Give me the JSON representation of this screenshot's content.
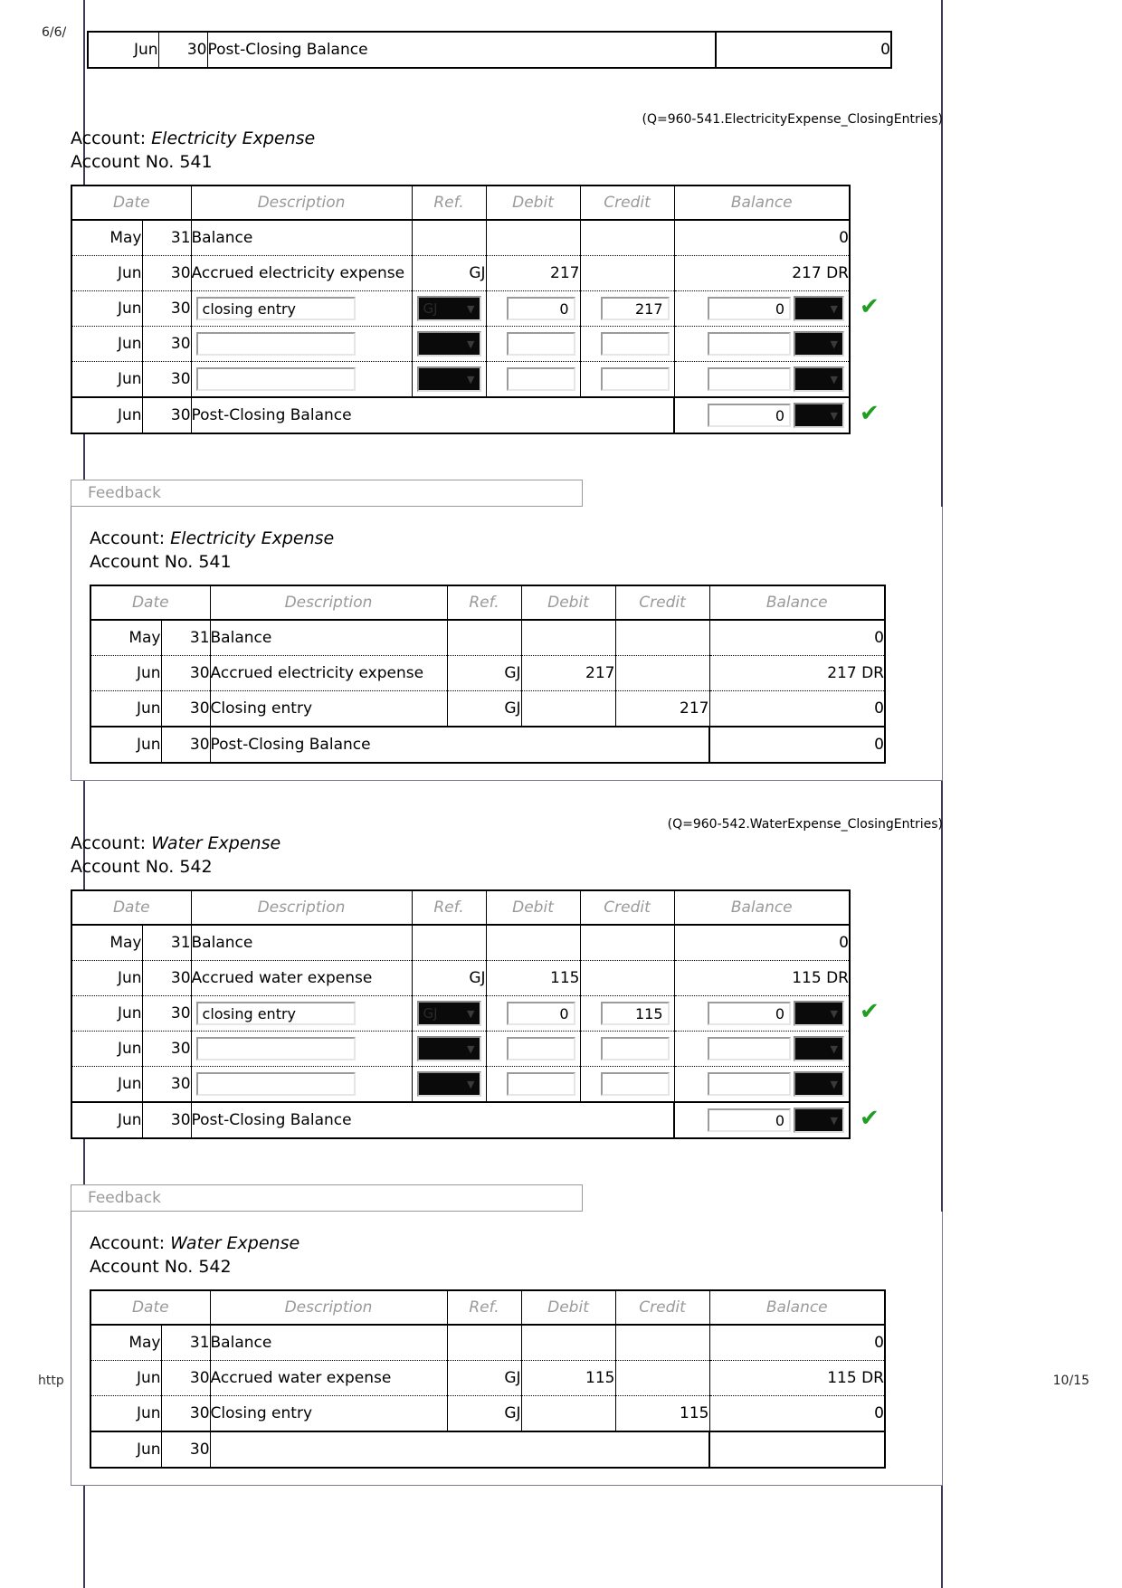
{
  "print": {
    "date_stamp": "6/6/",
    "url_stamp": "http",
    "page_number": "10/15"
  },
  "columns": [
    "Date",
    "Description",
    "Ref.",
    "Debit",
    "Credit",
    "Balance"
  ],
  "top_table": {
    "row": {
      "month": "Jun",
      "day": "30",
      "description": "Post-Closing Balance",
      "balance": "0"
    }
  },
  "sections": [
    {
      "question_id": "(Q=960-541.ElectricityExpense_ClosingEntries)",
      "account_label": "Account:",
      "account_name": "Electricity Expense",
      "account_no_label": "Account No. 541",
      "rows": [
        {
          "month": "May",
          "day": "31",
          "description": "Balance",
          "ref": "",
          "debit": "",
          "credit": "",
          "balance": "0",
          "type": "static"
        },
        {
          "month": "Jun",
          "day": "30",
          "description": "Accrued electricity expense",
          "ref": "GJ",
          "debit": "217",
          "credit": "",
          "balance": "217 DR",
          "type": "static"
        },
        {
          "month": "Jun",
          "day": "30",
          "description": "closing entry",
          "ref": "GJ",
          "debit": "0",
          "credit": "217",
          "balance": "0",
          "drcr": "",
          "type": "input",
          "checked": true
        },
        {
          "month": "Jun",
          "day": "30",
          "description": "",
          "ref": "",
          "debit": "",
          "credit": "",
          "balance": "",
          "drcr": "",
          "type": "input",
          "checked": false
        },
        {
          "month": "Jun",
          "day": "30",
          "description": "",
          "ref": "",
          "debit": "",
          "credit": "",
          "balance": "",
          "drcr": "",
          "type": "input",
          "checked": false
        }
      ],
      "post_row": {
        "month": "Jun",
        "day": "30",
        "description": "Post-Closing Balance",
        "balance": "0",
        "drcr": "",
        "checked": true
      },
      "feedback": {
        "label": "Feedback",
        "account_label": "Account:",
        "account_name": "Electricity Expense",
        "account_no_label": "Account No. 541",
        "rows": [
          {
            "month": "May",
            "day": "31",
            "description": "Balance",
            "ref": "",
            "debit": "",
            "credit": "",
            "balance": "0"
          },
          {
            "month": "Jun",
            "day": "30",
            "description": "Accrued electricity expense",
            "ref": "GJ",
            "debit": "217",
            "credit": "",
            "balance": "217 DR"
          },
          {
            "month": "Jun",
            "day": "30",
            "description": "Closing entry",
            "ref": "GJ",
            "debit": "",
            "credit": "217",
            "balance": "0"
          }
        ],
        "post_row": {
          "month": "Jun",
          "day": "30",
          "description": "Post-Closing Balance",
          "balance": "0"
        }
      }
    },
    {
      "question_id": "(Q=960-542.WaterExpense_ClosingEntries)",
      "account_label": "Account:",
      "account_name": "Water Expense",
      "account_no_label": "Account No. 542",
      "rows": [
        {
          "month": "May",
          "day": "31",
          "description": "Balance",
          "ref": "",
          "debit": "",
          "credit": "",
          "balance": "0",
          "type": "static"
        },
        {
          "month": "Jun",
          "day": "30",
          "description": "Accrued water expense",
          "ref": "GJ",
          "debit": "115",
          "credit": "",
          "balance": "115 DR",
          "type": "static"
        },
        {
          "month": "Jun",
          "day": "30",
          "description": "closing entry",
          "ref": "GJ",
          "debit": "0",
          "credit": "115",
          "balance": "0",
          "drcr": "",
          "type": "input",
          "checked": true
        },
        {
          "month": "Jun",
          "day": "30",
          "description": "",
          "ref": "",
          "debit": "",
          "credit": "",
          "balance": "",
          "drcr": "",
          "type": "input",
          "checked": false
        },
        {
          "month": "Jun",
          "day": "30",
          "description": "",
          "ref": "",
          "debit": "",
          "credit": "",
          "balance": "",
          "drcr": "",
          "type": "input",
          "checked": false
        }
      ],
      "post_row": {
        "month": "Jun",
        "day": "30",
        "description": "Post-Closing Balance",
        "balance": "0",
        "drcr": "",
        "checked": true
      },
      "feedback": {
        "label": "Feedback",
        "account_label": "Account:",
        "account_name": "Water Expense",
        "account_no_label": "Account No. 542",
        "rows": [
          {
            "month": "May",
            "day": "31",
            "description": "Balance",
            "ref": "",
            "debit": "",
            "credit": "",
            "balance": "0"
          },
          {
            "month": "Jun",
            "day": "30",
            "description": "Accrued water expense",
            "ref": "GJ",
            "debit": "115",
            "credit": "",
            "balance": "115 DR"
          },
          {
            "month": "Jun",
            "day": "30",
            "description": "Closing entry",
            "ref": "GJ",
            "debit": "",
            "credit": "115",
            "balance": "0"
          }
        ],
        "post_row": {
          "month": "Jun",
          "day": "30",
          "description": "",
          "balance": ""
        }
      }
    }
  ],
  "icons": {
    "dropdown_arrow": "▼",
    "check": "✔"
  }
}
